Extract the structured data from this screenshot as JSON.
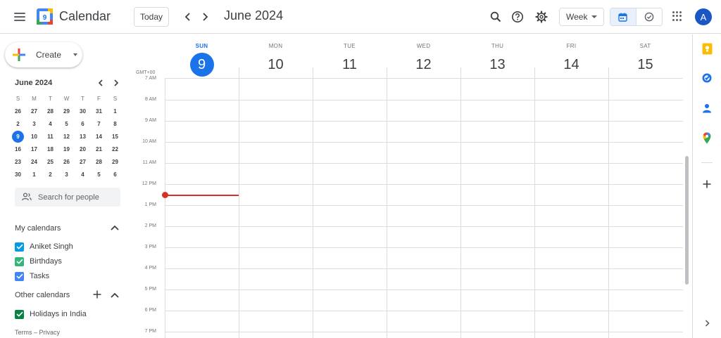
{
  "header": {
    "app_title": "Calendar",
    "logo_day": "9",
    "today_label": "Today",
    "current_period": "June 2024",
    "view_label": "Week",
    "avatar_letter": "A"
  },
  "sidebar": {
    "create_label": "Create",
    "mini_calendar": {
      "title": "June 2024",
      "weekdays": [
        "S",
        "M",
        "T",
        "W",
        "T",
        "F",
        "S"
      ],
      "weeks": [
        [
          "26",
          "27",
          "28",
          "29",
          "30",
          "31",
          "1"
        ],
        [
          "2",
          "3",
          "4",
          "5",
          "6",
          "7",
          "8"
        ],
        [
          "9",
          "10",
          "11",
          "12",
          "13",
          "14",
          "15"
        ],
        [
          "16",
          "17",
          "18",
          "19",
          "20",
          "21",
          "22"
        ],
        [
          "23",
          "24",
          "25",
          "26",
          "27",
          "28",
          "29"
        ],
        [
          "30",
          "1",
          "2",
          "3",
          "4",
          "5",
          "6"
        ]
      ],
      "today": "9"
    },
    "search_people_placeholder": "Search for people",
    "my_calendars_label": "My calendars",
    "my_calendars": [
      {
        "name": "Aniket Singh",
        "color": "#039be5"
      },
      {
        "name": "Birthdays",
        "color": "#33b679"
      },
      {
        "name": "Tasks",
        "color": "#4285f4"
      }
    ],
    "other_calendars_label": "Other calendars",
    "other_calendars": [
      {
        "name": "Holidays in India",
        "color": "#0b8043"
      }
    ],
    "footer": {
      "terms": "Terms",
      "separator": "–",
      "privacy": "Privacy"
    }
  },
  "week": {
    "timezone": "GMT+00",
    "days": [
      {
        "dow": "SUN",
        "num": "9",
        "today": true
      },
      {
        "dow": "MON",
        "num": "10",
        "today": false
      },
      {
        "dow": "TUE",
        "num": "11",
        "today": false
      },
      {
        "dow": "WED",
        "num": "12",
        "today": false
      },
      {
        "dow": "THU",
        "num": "13",
        "today": false
      },
      {
        "dow": "FRI",
        "num": "14",
        "today": false
      },
      {
        "dow": "SAT",
        "num": "15",
        "today": false
      }
    ],
    "hours": [
      "7 AM",
      "8 AM",
      "9 AM",
      "10 AM",
      "11 AM",
      "12 PM",
      "1 PM",
      "2 PM",
      "3 PM",
      "4 PM",
      "5 PM",
      "6 PM",
      "7 PM"
    ]
  },
  "side_panel": {
    "icons": [
      "keep-icon",
      "tasks-icon",
      "contacts-icon",
      "maps-icon",
      "add-icon"
    ]
  },
  "colors": {
    "accent": "#1a73e8",
    "now_indicator": "#d93025",
    "avatar_bg": "#1a56c4"
  }
}
